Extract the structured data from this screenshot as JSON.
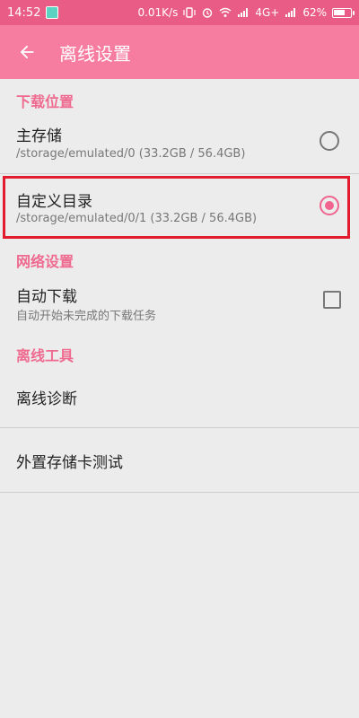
{
  "status_bar": {
    "time": "14:52",
    "network_speed": "0.01K/s",
    "network_type": "4G+",
    "battery_percent": "62%"
  },
  "app_bar": {
    "title": "离线设置",
    "back_icon": "arrow-left-icon"
  },
  "sections": {
    "download_location": {
      "header": "下载位置"
    },
    "network": {
      "header": "网络设置"
    },
    "offline_tools": {
      "header": "离线工具"
    }
  },
  "download_location": {
    "primary": {
      "title": "主存储",
      "path": "/storage/emulated/0 (33.2GB / 56.4GB)",
      "selected": false
    },
    "custom": {
      "title": "自定义目录",
      "path": "/storage/emulated/0/1 (33.2GB / 56.4GB)",
      "selected": true
    }
  },
  "network": {
    "auto_download": {
      "title": "自动下载",
      "subtitle": "自动开始未完成的下载任务",
      "checked": false
    }
  },
  "offline_tools": {
    "items": [
      {
        "label": "离线诊断"
      },
      {
        "label": "外置存储卡测试"
      }
    ]
  },
  "colors": {
    "status_bar": "#e95c86",
    "app_bar": "#f77da0",
    "accent": "#ef6a8f",
    "highlight": "#e21b2e"
  }
}
